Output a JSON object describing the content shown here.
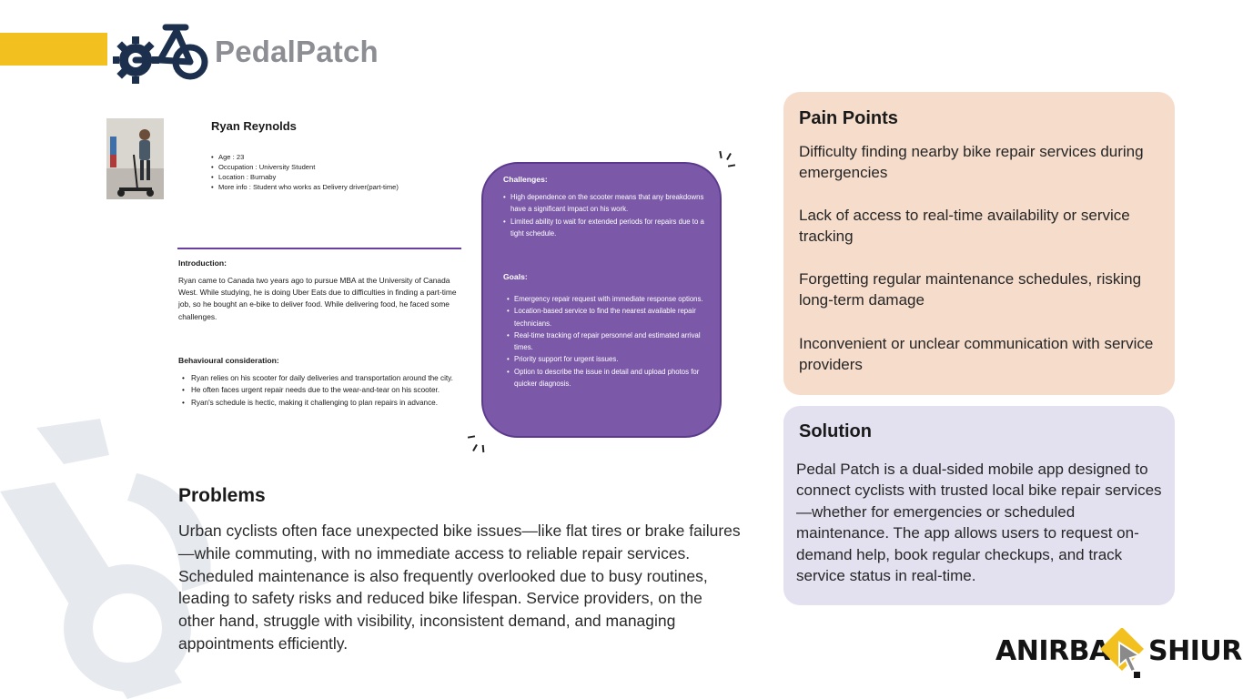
{
  "brand": {
    "name": "PedalPatch",
    "accent": "#f3c11f",
    "logo_color": "#1c2f4d"
  },
  "persona": {
    "name": "Ryan Reynolds",
    "details": [
      "Age : 23",
      "Occupation : University Student",
      "Location : Burnaby",
      "More info : Student who works as Delivery driver(part-time)"
    ],
    "intro_title": "Introduction:",
    "intro_body": "Ryan came to Canada two years ago to pursue MBA at the University of Canada West. While studying, he is doing Uber Eats due to difficulties in finding a part-time job, so he bought an e-bike to deliver food. While delivering food, he faced some challenges.",
    "behaviour_title": "Behavioural consideration:",
    "behaviour_items": [
      "Ryan relies on his scooter for daily deliveries and transportation around the city.",
      "He often faces urgent repair needs due to the wear-and-tear on his scooter.",
      "Ryan's schedule is hectic, making it challenging to plan repairs in advance."
    ]
  },
  "challenges_card": {
    "color": "#7b59a8",
    "challenges_title": "Challenges:",
    "challenges": [
      "High dependence on the scooter means that any breakdowns have a significant impact on his work.",
      "Limited ability to wait for extended periods for repairs due to a tight schedule."
    ],
    "goals_title": "Goals:",
    "goals": [
      "Emergency repair request with immediate response options.",
      "Location-based service to find the nearest available repair technicians.",
      "Real-time tracking of repair personnel and estimated arrival times.",
      "Priority support for urgent issues.",
      "Option to describe the issue in detail and upload photos for quicker diagnosis."
    ]
  },
  "problems": {
    "title": "Problems",
    "body": "Urban cyclists often face unexpected bike issues—like flat tires or brake failures—while commuting, with no immediate access to reliable repair services. Scheduled maintenance is also frequently overlooked due to busy routines, leading to safety risks and reduced bike lifespan. Service providers, on the other hand, struggle with visibility, inconsistent demand, and managing appointments efficiently."
  },
  "pain_points": {
    "title": "Pain Points",
    "color": "#f6dccb",
    "items": [
      "Difficulty finding nearby bike repair services during emergencies",
      "Lack of access to real-time availability or service tracking",
      "Forgetting regular maintenance schedules, risking long-term damage",
      "Inconvenient or unclear communication with service providers"
    ]
  },
  "solution": {
    "title": "Solution",
    "color": "#e3e1f0",
    "body": "Pedal Patch is a dual-sided mobile app designed to connect cyclists with trusted local bike repair services—whether for emergencies or scheduled maintenance. The app allows users to request on-demand help, book regular checkups, and track service status in real-time."
  },
  "signature": {
    "left": "ANIRBAN",
    "right": "SHIUR",
    "accent": "#f3c11f"
  }
}
